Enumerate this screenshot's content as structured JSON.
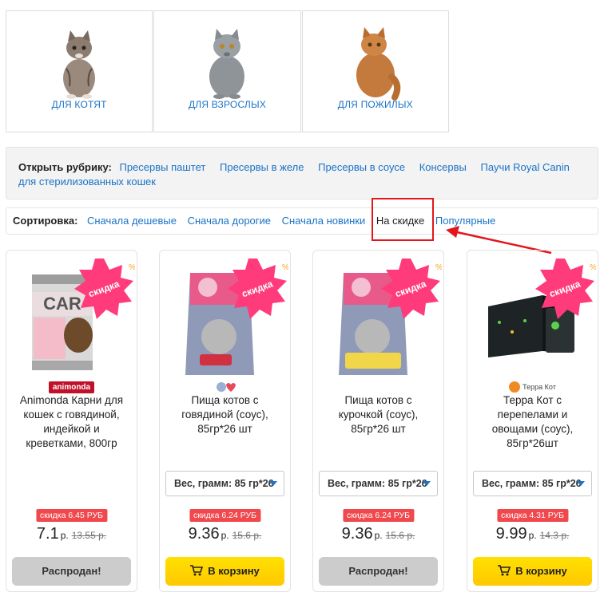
{
  "age_categories": [
    {
      "label": "ДЛЯ КОТЯТ",
      "icon": "kitten-image"
    },
    {
      "label": "ДЛЯ ВЗРОСЛЫХ",
      "icon": "adult-cat-image"
    },
    {
      "label": "ДЛЯ ПОЖИЛЫХ",
      "icon": "senior-cat-image"
    }
  ],
  "rubric": {
    "title": "Открыть рубрику:",
    "links": [
      "Пресервы паштет",
      "Пресервы в желе",
      "Пресервы в соусе",
      "Консервы",
      "Паучи Royal Canin",
      "для стерилизованных кошек"
    ]
  },
  "sort": {
    "title": "Сортировка:",
    "options": [
      "Сначала дешевые",
      "Сначала дорогие",
      "Сначала новинки",
      "На скидке",
      "Популярные"
    ],
    "active": "На скидке"
  },
  "badge_text": "скидка",
  "products": [
    {
      "brand": "animonda",
      "name": "Animonda Карни для кошек с говядиной, индейкой и креветками, 800гр",
      "weight": "",
      "discount": "скидка 6.45 РУБ",
      "price": "7.1",
      "currency": "р.",
      "old_price": "13.55 р.",
      "button": "Распродан!",
      "available": false
    },
    {
      "brand": "",
      "name": "Пища котов с говядиной (соус), 85гр*26 шт",
      "weight": "Вес, грамм: 85 гр*26",
      "discount": "скидка 6.24 РУБ",
      "price": "9.36",
      "currency": "р.",
      "old_price": "15.6 р.",
      "button": "В корзину",
      "available": true
    },
    {
      "brand": "",
      "name": "Пища котов с курочкой (соус), 85гр*26 шт",
      "weight": "Вес, грамм: 85 гр*26",
      "discount": "скидка 6.24 РУБ",
      "price": "9.36",
      "currency": "р.",
      "old_price": "15.6 р.",
      "button": "Распродан!",
      "available": false
    },
    {
      "brand": "Терра Кот",
      "name": "Терра Кот с перепелами и овощами (соус), 85гр*26шт",
      "weight": "Вес, грамм: 85 гр*26",
      "discount": "скидка 4.31 РУБ",
      "price": "9.99",
      "currency": "р.",
      "old_price": "14.3 р.",
      "button": "В корзину",
      "available": true
    }
  ],
  "colors": {
    "link": "#1a73c7",
    "discount": "#f0484d",
    "highlight": "#e3161b",
    "cart": "#ffd200"
  }
}
